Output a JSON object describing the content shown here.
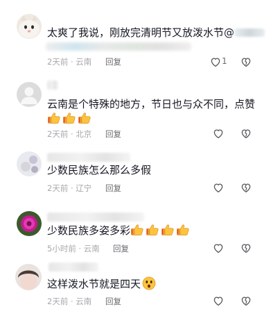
{
  "comments": [
    {
      "text": "太爽了我说，刚放完清明节又放泼水节@",
      "time": "2天前",
      "location": "云南",
      "reply_label": "回复",
      "like_count": "1"
    },
    {
      "text": "云南是个特殊的地方，节日也与众不同，点赞",
      "time": "2天前",
      "location": "北京",
      "reply_label": "回复",
      "like_count": ""
    },
    {
      "text": "少数民族怎么那么多假",
      "time": "2天前",
      "location": "辽宁",
      "reply_label": "回复",
      "like_count": ""
    },
    {
      "text": "少数民族多姿多彩",
      "time": "5小时前",
      "location": "云南",
      "reply_label": "回复",
      "like_count": ""
    },
    {
      "text": "这样泼水节就是四天",
      "time": "2天前",
      "location": "云南",
      "reply_label": "回复",
      "like_count": ""
    }
  ],
  "icons": {
    "like": "heart-outline-icon",
    "dislike": "broken-heart-outline-icon",
    "thumbs_up": "thumbs-up-emoji",
    "shocked_face": "shocked-face-emoji"
  },
  "colors": {
    "text": "#161823",
    "meta": "#a8a8ad",
    "reply": "#6b6b70"
  }
}
